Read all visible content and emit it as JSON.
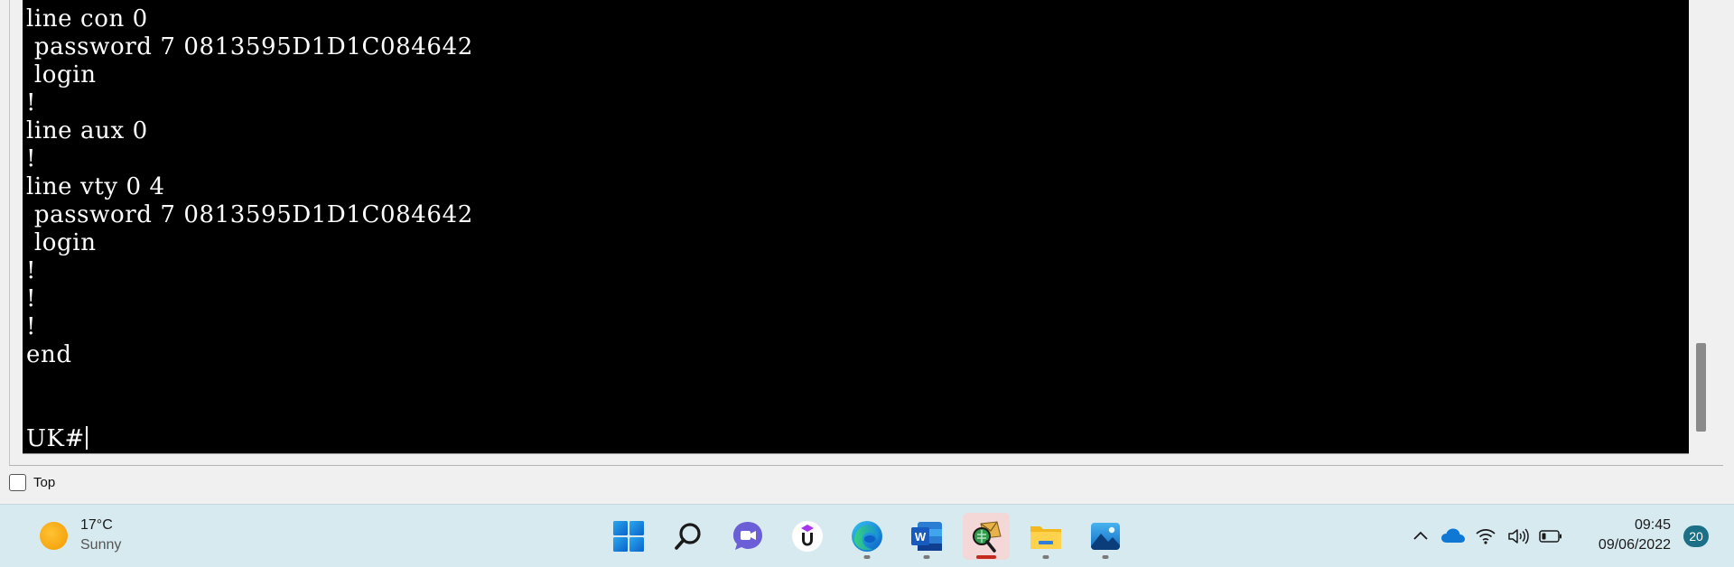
{
  "terminal": {
    "lines": [
      "line con 0",
      " password 7 0813595D1D1C084642",
      " login",
      "!",
      "line aux 0",
      "!",
      "line vty 0 4",
      " password 7 0813595D1D1C084642",
      " login",
      "!",
      "!",
      "!",
      "end"
    ],
    "prompt": "UK#"
  },
  "window": {
    "top_checkbox_label": "Top",
    "top_checked": false
  },
  "taskbar": {
    "weather": {
      "temperature": "17°C",
      "condition": "Sunny",
      "icon": "sun-icon"
    },
    "apps": [
      {
        "name": "start",
        "icon": "windows-start-icon"
      },
      {
        "name": "search",
        "icon": "search-icon"
      },
      {
        "name": "chat",
        "icon": "teams-chat-icon"
      },
      {
        "name": "udemy",
        "icon": "udemy-icon"
      },
      {
        "name": "edge",
        "icon": "edge-icon"
      },
      {
        "name": "word",
        "icon": "word-icon"
      },
      {
        "name": "packet-tracer",
        "icon": "packet-tracer-icon",
        "active": true
      },
      {
        "name": "file-explorer",
        "icon": "folder-icon"
      },
      {
        "name": "photos",
        "icon": "photos-icon"
      }
    ],
    "tray": {
      "icons": [
        "chevron-up-icon",
        "onedrive-cloud-icon",
        "wifi-icon",
        "volume-icon",
        "battery-icon"
      ],
      "time": "09:45",
      "date": "09/06/2022",
      "notification_count": "20"
    }
  },
  "colors": {
    "terminal_bg": "#000000",
    "terminal_fg": "#ffffff",
    "taskbar_bg": "#d7eaf0",
    "active_indicator": "#c42b1c"
  }
}
